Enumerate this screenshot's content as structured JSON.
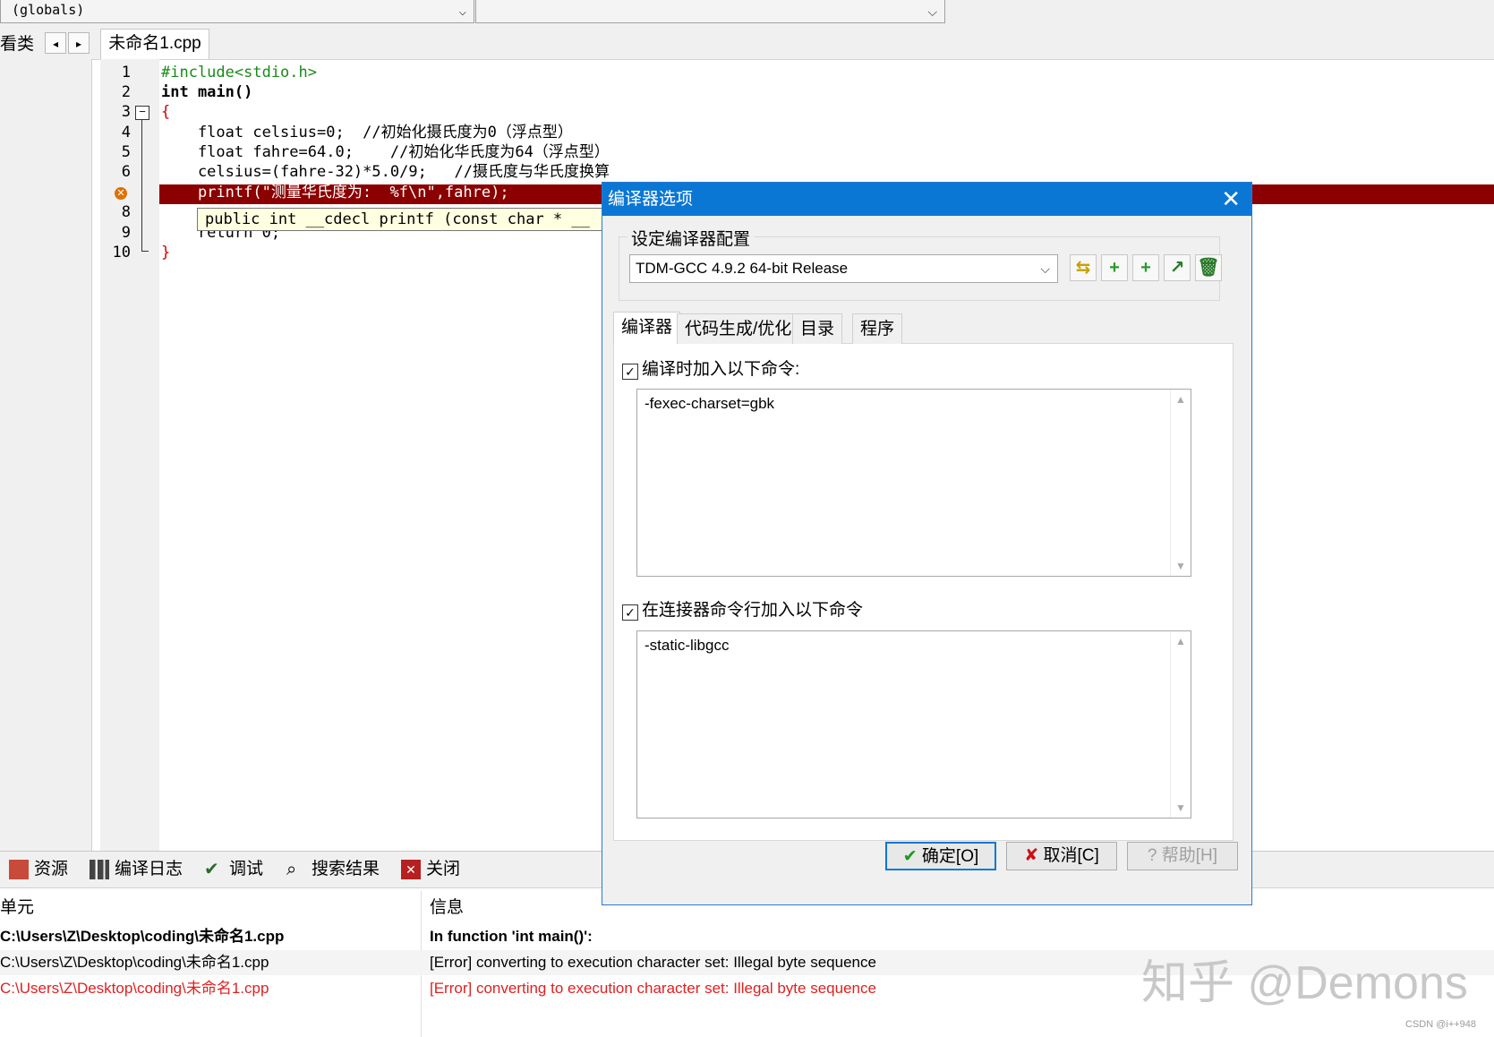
{
  "top": {
    "combo_left": "(globals)",
    "combo_right": ""
  },
  "tabs": {
    "left_label": "看类",
    "file_tab": "未命名1.cpp"
  },
  "editor": {
    "lines": [
      {
        "n": "1",
        "text": "#include<stdio.h>"
      },
      {
        "n": "2",
        "text": "int main()"
      },
      {
        "n": "3",
        "text": "{"
      },
      {
        "n": "4",
        "text": "    float celsius=0;  //初始化摄氏度为0（浮点型）"
      },
      {
        "n": "5",
        "text": "    float fahre=64.0;    //初始化华氏度为64（浮点型）"
      },
      {
        "n": "6",
        "text": "    celsius=(fahre-32)*5.0/9;   //摄氏度与华氏度换算"
      },
      {
        "n": "7",
        "text": "    printf(\"测量华氏度为:  %f\\n\",fahre);"
      },
      {
        "n": "8",
        "text": ""
      },
      {
        "n": "9",
        "text": "    return 0;"
      },
      {
        "n": "10",
        "text": "}"
      }
    ],
    "tooltip": "public int __cdecl printf (const char * __"
  },
  "dialog": {
    "title": "编译器选项",
    "group_label": "设定编译器配置",
    "profile": "TDM-GCC 4.9.2 64-bit Release",
    "tabs": [
      "编译器",
      "代码生成/优化",
      "目录",
      "程序"
    ],
    "compile_check_label": "编译时加入以下命令:",
    "compile_cmd": "-fexec-charset=gbk",
    "linker_check_label": "在连接器命令行加入以下命令",
    "linker_cmd": "-static-libgcc",
    "ok": "确定[O]",
    "cancel": "取消[C]",
    "help": "帮助[H]"
  },
  "bottom": {
    "tabs": [
      "资源",
      "编译日志",
      "调试",
      "搜索结果",
      "关闭"
    ],
    "col_unit": "单元",
    "col_info": "信息",
    "rows": [
      {
        "unit": "C:\\Users\\Z\\Desktop\\coding\\未命名1.cpp",
        "info": "In function 'int main()':"
      },
      {
        "unit": "C:\\Users\\Z\\Desktop\\coding\\未命名1.cpp",
        "info": "[Error] converting to execution character set: Illegal byte sequence"
      },
      {
        "unit": "C:\\Users\\Z\\Desktop\\coding\\未命名1.cpp",
        "info": "[Error] converting to execution character set: Illegal byte sequence"
      }
    ]
  },
  "watermark": "知乎 @Demons",
  "csdn": "CSDN @i++948"
}
